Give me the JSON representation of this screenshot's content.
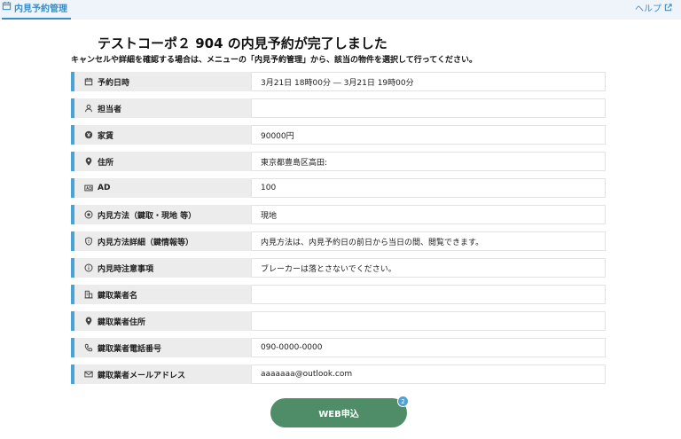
{
  "header": {
    "tab_label": "内見予約管理",
    "help_label": "ヘルプ"
  },
  "main": {
    "title": "テストコーポ２ 904 の内見予約が完了しました",
    "subtitle": "キャンセルや詳細を確認する場合は、メニューの「内見予約管理」から、該当の物件を選択して行ってください。"
  },
  "details": [
    {
      "label": "予約日時",
      "value": "3月21日 18時00分 ― 3月21日 19時00分",
      "icon": "calendar-icon"
    },
    {
      "label": "担当者",
      "value": "",
      "icon": "person-icon"
    },
    {
      "label": "家賃",
      "value": "90000円",
      "icon": "yen-coin-icon"
    },
    {
      "label": "住所",
      "value": "東京都豊島区高田:",
      "icon": "location-pin-icon"
    },
    {
      "label": "AD",
      "value": "100",
      "icon": "ad-card-icon"
    },
    {
      "label": "内見方法（鍵取・現地 等）",
      "value": "現地",
      "icon": "target-icon"
    },
    {
      "label": "内見方法詳細（鍵情報等）",
      "value": "内見方法は、内見予約日の前日から当日の間、閲覧できます。",
      "icon": "shield-icon"
    },
    {
      "label": "内見時注意事項",
      "value": "ブレーカーは落とさないでください。",
      "icon": "info-icon"
    },
    {
      "label": "鍵取業者名",
      "value": "",
      "icon": "building-icon"
    },
    {
      "label": "鍵取業者住所",
      "value": "",
      "icon": "location-pin-icon"
    },
    {
      "label": "鍵取業者電話番号",
      "value": "090-0000-0000",
      "icon": "phone-icon"
    },
    {
      "label": "鍵取業者メールアドレス",
      "value": "aaaaaaa@outlook.com",
      "icon": "mail-icon"
    }
  ],
  "actions": {
    "web_apply_label": "WEB申込",
    "web_apply_badge": "2"
  },
  "colors": {
    "accent": "#4aa3d6",
    "button": "#4f8c68"
  }
}
